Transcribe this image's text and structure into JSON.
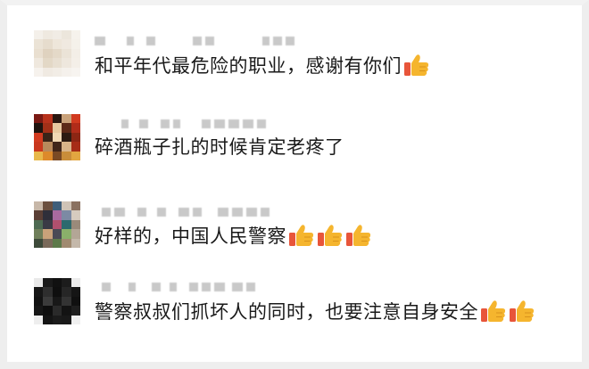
{
  "comments": [
    {
      "text": "和平年代最危险的职业，感谢有你们",
      "thumbs": 1,
      "avatar_colors": [
        "#f4f0ea",
        "#efe9e0",
        "#f1ece5",
        "#ece6dc",
        "#f6f2ec",
        "#ebe3d6",
        "#e6dccd",
        "#eee6da",
        "#f0e9e0",
        "#f5f1ea",
        "#e9dfd0",
        "#dfd2bf",
        "#e4d9c8",
        "#ebe3d7",
        "#f3eee7",
        "#efe8de",
        "#e3d8c6",
        "#e8dfd1",
        "#eee7dd",
        "#f4efe8",
        "#f6f2ed",
        "#f0eae2",
        "#f2ede6",
        "#f5f1ec",
        "#f7f4f0"
      ]
    },
    {
      "text": "碎酒瓶子扎的时候肯定老疼了",
      "thumbs": 0,
      "avatar_colors": [
        "#7a1a14",
        "#b8321c",
        "#2a1710",
        "#c9a27a",
        "#d13a1f",
        "#1f140f",
        "#a23018",
        "#e7c9a0",
        "#5c2a18",
        "#b02c1a",
        "#d23b20",
        "#3a2418",
        "#f0d8b4",
        "#2c1b12",
        "#8c2614",
        "#c9371d",
        "#b88a5c",
        "#40261a",
        "#d9b488",
        "#a62d17",
        "#e8b84a",
        "#dd8a2a",
        "#7a4a24",
        "#c98d3a",
        "#e2a640"
      ]
    },
    {
      "text": "好样的，中国人民警察",
      "thumbs": 3,
      "avatar_colors": [
        "#c7b7a8",
        "#6b4f3e",
        "#3f5e7a",
        "#cfc3b6",
        "#8a7160",
        "#5a3f35",
        "#2f2f3a",
        "#a86aa0",
        "#7c8aa4",
        "#d6cbbf",
        "#4e6a52",
        "#3a3a45",
        "#b0506e",
        "#2c6a6e",
        "#9a8a7a",
        "#6f7f5a",
        "#c9a27a",
        "#4a4a55",
        "#8ab06a",
        "#b3a696",
        "#3d4a3a",
        "#7a6a5a",
        "#5d7a4a",
        "#a08a70",
        "#c4b8aa"
      ]
    },
    {
      "text": "警察叔叔们抓坏人的同时，也要注意自身安全",
      "thumbs": 2,
      "avatar_colors": [
        "#e9e9e9",
        "#1a1a1a",
        "#111111",
        "#1c1c1c",
        "#ececec",
        "#161616",
        "#2e2e2e",
        "#0f0f0f",
        "#262626",
        "#151515",
        "#121212",
        "#3b3b3b",
        "#181818",
        "#333333",
        "#101010",
        "#171717",
        "#0e0e0e",
        "#2a2a2a",
        "#131313",
        "#1e1e1e",
        "#eeeeee",
        "#141414",
        "#1b1b1b",
        "#191919",
        "#f0f0f0"
      ]
    }
  ],
  "colors": {
    "text": "#1a1a1a",
    "name_blur": "#c9c9c9",
    "thumb_fill": "#f5b52e",
    "thumb_cuff": "#e8553a"
  },
  "icons": {
    "reaction": "thumbs-up-icon"
  }
}
